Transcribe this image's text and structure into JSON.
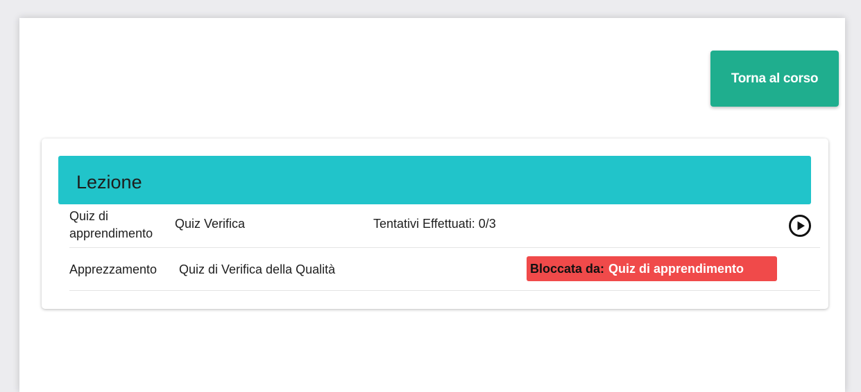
{
  "header": {
    "back_button_label": "Torna al corso"
  },
  "lesson": {
    "title": "Lezione",
    "items": [
      {
        "type": "Quiz di apprendimento",
        "name": "Quiz Verifica",
        "attempts": "Tentativi Effettuati: 0/3",
        "action_icon": "play-circle-icon"
      },
      {
        "type": "Apprezzamento",
        "name": "Quiz di Verifica della Qualità",
        "blocked_label": "Bloccata da:",
        "blocked_by": "Quiz di apprendimento"
      }
    ]
  },
  "colors": {
    "back_button": "#1fae8e",
    "card_header": "#21c4ca",
    "blocked_badge": "#f04a4a"
  }
}
